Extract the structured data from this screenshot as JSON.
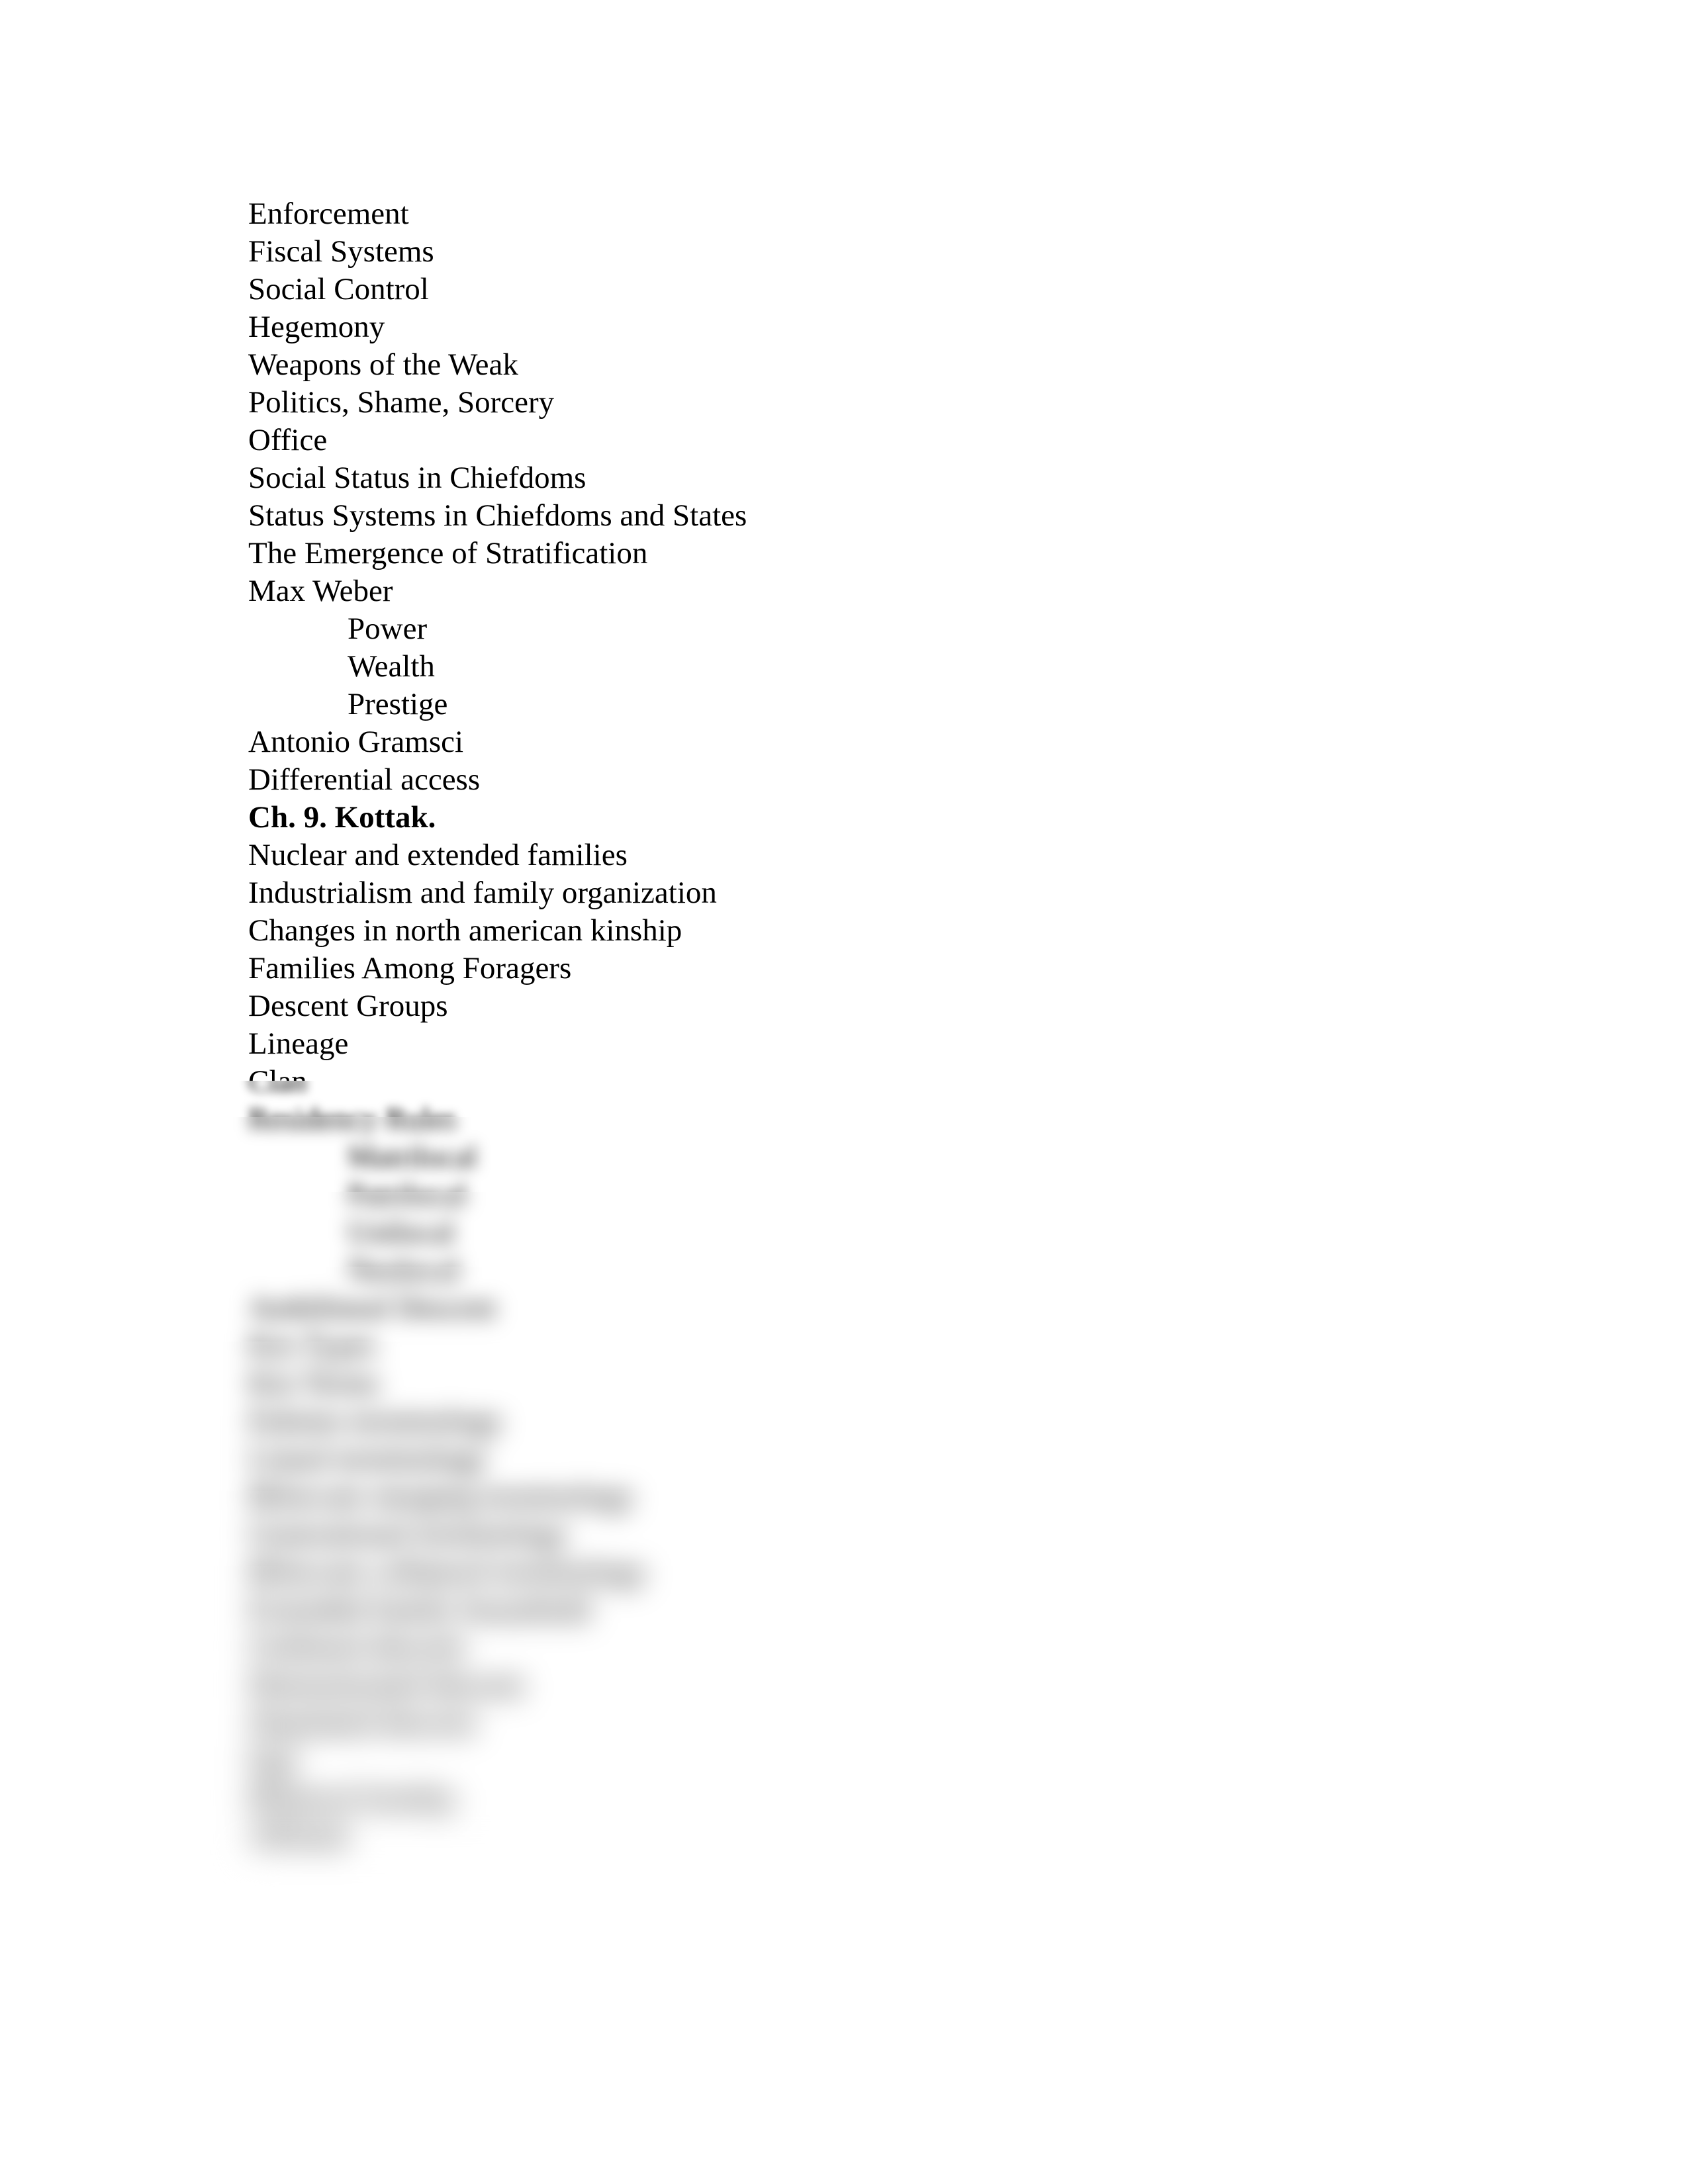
{
  "document": {
    "page_background": "#ffffff",
    "text_color": "#000000",
    "lines": [
      {
        "text": "Enforcement",
        "indent": 0,
        "bold": false
      },
      {
        "text": "Fiscal Systems",
        "indent": 0,
        "bold": false
      },
      {
        "text": "Social Control",
        "indent": 0,
        "bold": false
      },
      {
        "text": "Hegemony",
        "indent": 0,
        "bold": false
      },
      {
        "text": "Weapons of the Weak",
        "indent": 0,
        "bold": false
      },
      {
        "text": "Politics, Shame, Sorcery",
        "indent": 0,
        "bold": false
      },
      {
        "text": "Office",
        "indent": 0,
        "bold": false
      },
      {
        "text": "Social Status in Chiefdoms",
        "indent": 0,
        "bold": false
      },
      {
        "text": "Status Systems in Chiefdoms and States",
        "indent": 0,
        "bold": false
      },
      {
        "text": "The Emergence of Stratification",
        "indent": 0,
        "bold": false
      },
      {
        "text": "Max Weber",
        "indent": 0,
        "bold": false
      },
      {
        "text": "Power",
        "indent": 1,
        "bold": false
      },
      {
        "text": "Wealth",
        "indent": 1,
        "bold": false
      },
      {
        "text": "Prestige",
        "indent": 1,
        "bold": false
      },
      {
        "text": "Antonio Gramsci",
        "indent": 0,
        "bold": false
      },
      {
        "text": "Differential access",
        "indent": 0,
        "bold": false
      },
      {
        "text": "",
        "indent": 0,
        "bold": false
      },
      {
        "text": "Ch. 9. Kottak.",
        "indent": 0,
        "bold": true
      },
      {
        "text": "",
        "indent": 0,
        "bold": false
      },
      {
        "text": "Nuclear and extended families",
        "indent": 0,
        "bold": false
      },
      {
        "text": "Industrialism and family organization",
        "indent": 0,
        "bold": false
      },
      {
        "text": "Changes in north american kinship",
        "indent": 0,
        "bold": false
      },
      {
        "text": "Families Among Foragers",
        "indent": 0,
        "bold": false
      },
      {
        "text": "Descent Groups",
        "indent": 0,
        "bold": false
      },
      {
        "text": "Lineage",
        "indent": 0,
        "bold": false
      },
      {
        "text": "Clan",
        "indent": 0,
        "bold": false
      },
      {
        "text": "Residency Rules",
        "indent": 0,
        "bold": false
      },
      {
        "text": "Matrilocal",
        "indent": 1,
        "bold": false
      },
      {
        "text": "Patrilocal",
        "indent": 1,
        "bold": false
      },
      {
        "text": "Unilocal",
        "indent": 1,
        "bold": false
      },
      {
        "text": "Neolocal",
        "indent": 1,
        "bold": false
      },
      {
        "text": "Ambilineal Descent",
        "indent": 0,
        "bold": false
      },
      {
        "text": "Kin Types",
        "indent": 0,
        "bold": false
      },
      {
        "text": "Kin Terms",
        "indent": 0,
        "bold": false
      },
      {
        "text": "Eskimo terminology",
        "indent": 0,
        "bold": false
      },
      {
        "text": "Lineal terminology",
        "indent": 0,
        "bold": false
      },
      {
        "text": "Bifurcate merging terminology",
        "indent": 0,
        "bold": false
      },
      {
        "text": "Generational terminology",
        "indent": 0,
        "bold": false
      },
      {
        "text": "Bifurcate collateral terminology",
        "indent": 0,
        "bold": false
      },
      {
        "text": "Extended family household",
        "indent": 0,
        "bold": false
      },
      {
        "text": "Unilineal descent",
        "indent": 0,
        "bold": false
      },
      {
        "text": "Demonstrated descent",
        "indent": 0,
        "bold": false
      },
      {
        "text": "Stipulated descent",
        "indent": 0,
        "bold": false
      },
      {
        "text": "Ego",
        "indent": 0,
        "bold": false
      },
      {
        "text": "Bilateral kinship",
        "indent": 0,
        "bold": false
      },
      {
        "text": "Affinals",
        "indent": 0,
        "bold": false
      }
    ]
  }
}
